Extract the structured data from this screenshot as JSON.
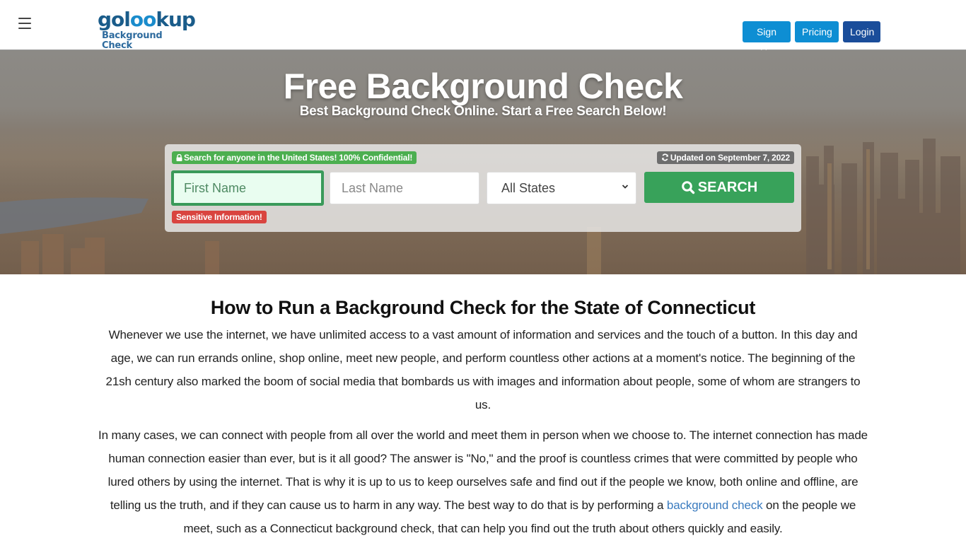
{
  "header": {
    "menu_icon": "hamburger-icon",
    "logo": {
      "part1": "gol",
      "part2": "oo",
      "part3": "kup",
      "subtitle": "Background Check"
    },
    "nav": {
      "signup": "Sign Up",
      "pricing": "Pricing",
      "login": "Login"
    }
  },
  "hero": {
    "title": "Free Background Check",
    "subtitle": "Best Background Check Online. Start a Free Search Below!",
    "search": {
      "confidential_badge": "Search for anyone in the United States! 100% Confidential!",
      "updated_badge": "Updated on September 7, 2022",
      "first_name_placeholder": "First Name",
      "last_name_placeholder": "Last Name",
      "state_selected": "All States",
      "search_button": "SEARCH",
      "warning_badge": "Sensitive Information!"
    },
    "colors": {
      "green": "#38a25a",
      "red": "#d9443f",
      "blue": "#0e8ed3",
      "navy": "#1a4d9a"
    }
  },
  "article": {
    "heading": "How to Run a Background Check for the State of Connecticut",
    "paragraph1": "Whenever we use the internet, we have unlimited access to a vast amount of information and services and the touch of a button. In this day and age, we can run errands online, shop online, meet new people, and perform countless other actions at a moment's notice. The beginning of the 21sh century also marked the boom of social media that bombards us with images and information about people, some of whom are strangers to us.",
    "paragraph2_before": "In many cases, we can connect with people from all over the world and meet them in person when we choose to. The internet connection has made human connection easier than ever, but is it all good? The answer is \"No,\" and the proof is countless crimes that were committed by people who lured others by using the internet. That is why it is up to us to keep ourselves safe and find out if the people we know, both online and offline, are telling us the truth, and if they can cause us to harm in any way. The best way to do that is by performing a ",
    "paragraph2_link": "background check",
    "paragraph2_after": " on the people we meet, such as a Connecticut background check, that can help you find out the truth about others quickly and easily."
  }
}
